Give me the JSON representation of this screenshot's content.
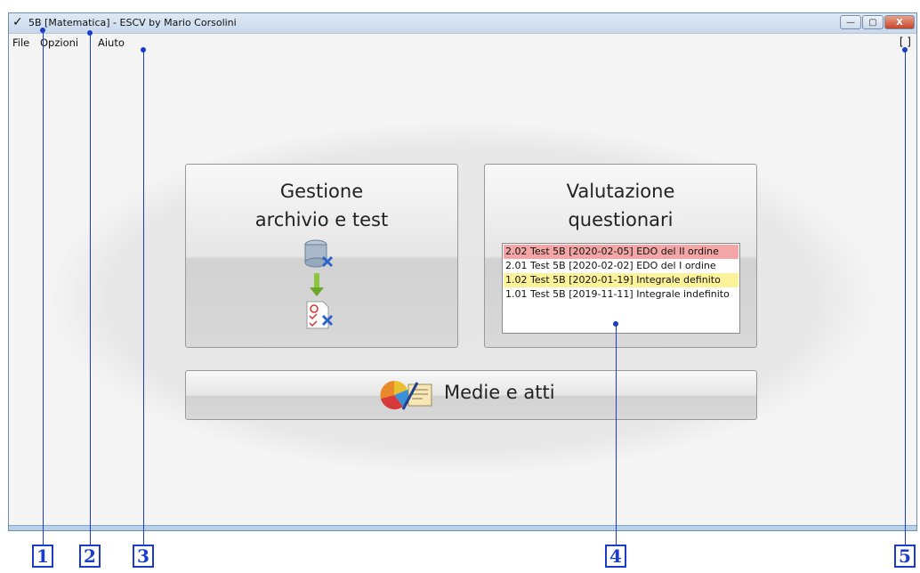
{
  "window": {
    "check_glyph": "✓",
    "title": "5B [Matematica] - ESCV by Mario Corsolini",
    "controls": {
      "minimize": "—",
      "maximize": "▢",
      "close": "X"
    }
  },
  "menu": {
    "items": [
      "File",
      "Opzioni",
      "Aiuto"
    ],
    "right_bracket": "[ ]"
  },
  "tiles": {
    "gestione": {
      "line1": "Gestione",
      "line2": "archivio e test"
    },
    "valutazione": {
      "line1": "Valutazione",
      "line2": "questionari",
      "list": [
        {
          "text": "2.02 Test 5B [2020-02-05] EDO del II ordine",
          "highlight": "#f4a6a6"
        },
        {
          "text": "2.01 Test 5B [2020-02-02] EDO del I ordine",
          "highlight": ""
        },
        {
          "text": "1.02 Test 5B [2020-01-19] Integrale definito",
          "highlight": "#fbf29a"
        },
        {
          "text": "1.01 Test 5B [2019-11-11] Integrale indefinito",
          "highlight": ""
        }
      ]
    },
    "medie": {
      "label": "Medie e atti"
    }
  },
  "annotations": [
    "1",
    "2",
    "3",
    "4",
    "5"
  ],
  "colors": {
    "accent": "#1a3cc8",
    "row_red": "#f4a6a6",
    "row_yellow": "#fbf29a"
  }
}
